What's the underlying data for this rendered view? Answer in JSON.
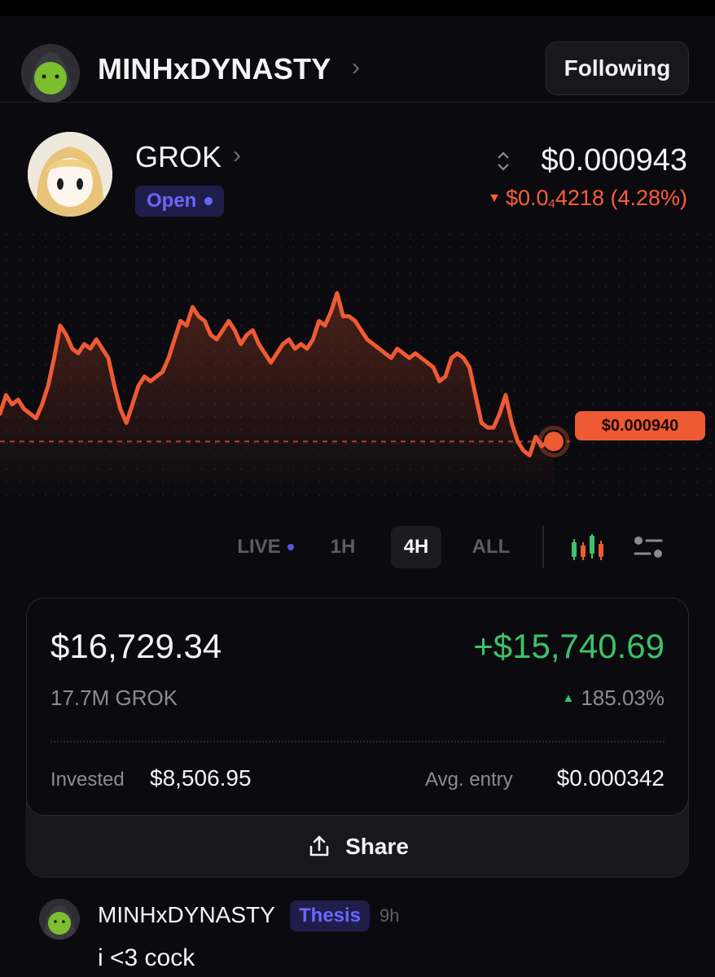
{
  "profile": {
    "name": "MINHxDYNASTY",
    "follow_label": "Following"
  },
  "token": {
    "name": "GROK",
    "status": "Open",
    "price": "$0.000943",
    "change_prefix": "$0.0",
    "change_subscript": "4",
    "change_suffix": "4218 (4.28%)",
    "chart_price_tag": "$0.000940"
  },
  "chart_data": {
    "type": "line",
    "x": [
      0,
      1,
      2,
      3,
      4,
      5,
      6,
      7,
      8,
      9,
      10,
      11,
      12,
      13,
      14,
      15,
      16,
      17,
      18,
      19,
      20,
      21,
      22,
      23,
      24,
      25,
      26,
      27,
      28,
      29,
      30,
      31,
      32,
      33,
      34,
      35,
      36,
      37,
      38,
      39,
      40,
      41,
      42,
      43,
      44,
      45,
      46,
      47,
      48,
      49,
      50,
      51,
      52,
      53,
      54,
      55,
      56,
      57,
      58,
      59,
      60,
      61,
      62,
      63,
      64,
      65,
      66,
      67,
      68,
      69,
      70,
      71,
      72,
      73,
      74,
      75,
      76,
      77,
      78,
      79,
      80,
      81,
      82,
      83,
      84,
      85,
      86,
      87,
      88,
      89,
      90,
      91,
      92,
      93,
      94,
      95,
      96,
      97,
      98,
      99,
      100,
      101,
      102,
      103,
      104,
      105,
      106,
      107,
      108,
      109,
      110,
      111,
      112,
      113,
      114,
      115,
      116,
      117,
      118,
      119,
      120,
      121,
      122,
      123,
      124,
      125
    ],
    "values": [
      0.000946,
      0.00095,
      0.000948,
      0.000949,
      0.000947,
      0.000946,
      0.000945,
      0.000948,
      0.000952,
      0.000958,
      0.000965,
      0.000963,
      0.00096,
      0.000959,
      0.000961,
      0.00096,
      0.000962,
      0.00096,
      0.000958,
      0.000952,
      0.000947,
      0.000944,
      0.000948,
      0.000952,
      0.000954,
      0.000953,
      0.000954,
      0.000955,
      0.000958,
      0.000962,
      0.000966,
      0.000965,
      0.000969,
      0.000967,
      0.000966,
      0.000963,
      0.000962,
      0.000964,
      0.000966,
      0.000964,
      0.000961,
      0.000963,
      0.000964,
      0.000961,
      0.000959,
      0.000957,
      0.000959,
      0.000961,
      0.000962,
      0.00096,
      0.000961,
      0.00096,
      0.000962,
      0.000966,
      0.000965,
      0.000968,
      0.000972,
      0.000967,
      0.000967,
      0.000966,
      0.000964,
      0.000962,
      0.000961,
      0.00096,
      0.000959,
      0.000958,
      0.00096,
      0.000959,
      0.000958,
      0.000959,
      0.000958,
      0.000957,
      0.000956,
      0.000953,
      0.000954,
      0.000958,
      0.000959,
      0.000958,
      0.000956,
      0.00095,
      0.000944,
      0.000943,
      0.000943,
      0.000946,
      0.00095,
      0.000944,
      0.00094,
      0.000938,
      0.000937,
      0.000941,
      0.000939,
      0.00094,
      0.00094
    ],
    "reference_price": 0.00094,
    "active_range": "4H"
  },
  "ranges": [
    {
      "label": "LIVE"
    },
    {
      "label": "1H"
    },
    {
      "label": "4H"
    },
    {
      "label": "ALL"
    }
  ],
  "position": {
    "value": "$16,729.34",
    "pnl": "+$15,740.69",
    "holding": "17.7M GROK",
    "pnl_percent": "185.03%",
    "invested_label": "Invested",
    "invested_value": "$8,506.95",
    "entry_label": "Avg. entry",
    "entry_value": "$0.000342",
    "share_label": "Share"
  },
  "comment": {
    "author": "MINHxDYNASTY",
    "badge": "Thesis",
    "time": "9h",
    "text": "i <3 cock"
  },
  "colors": {
    "accent_purple": "#6b66ff",
    "down_orange": "#ff5d37",
    "up_green": "#3cc26a",
    "chart_line": "#ee5a33"
  }
}
